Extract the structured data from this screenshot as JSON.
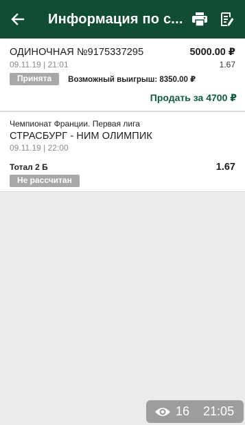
{
  "header": {
    "title": "Информация по с...",
    "back_icon": "arrow-left-icon",
    "print_icon": "printer-icon",
    "edit_icon": "edit-note-icon",
    "bg_color": "#114d34"
  },
  "bet": {
    "title": "ОДИНОЧНАЯ №9175337295",
    "amount": "5000.00 ₽",
    "datetime": "09.11.19 | 21:01",
    "coef": "1.67",
    "status": "Принята",
    "possible_win": "Возможный выигрыш: 8350.00 ₽",
    "sell_label": "Продать за 4700 ₽"
  },
  "event": {
    "league": "Чемпионат Франции. Первая лига",
    "match": "СТРАСБУРГ - НИМ ОЛИМПИК",
    "datetime": "09.11.19 | 22:00",
    "outcome": "Тотал 2 Б",
    "coef": "1.67",
    "status": "Не рассчитан"
  },
  "overlay": {
    "views": "16",
    "time": "21:05",
    "icon": "eye-icon"
  }
}
